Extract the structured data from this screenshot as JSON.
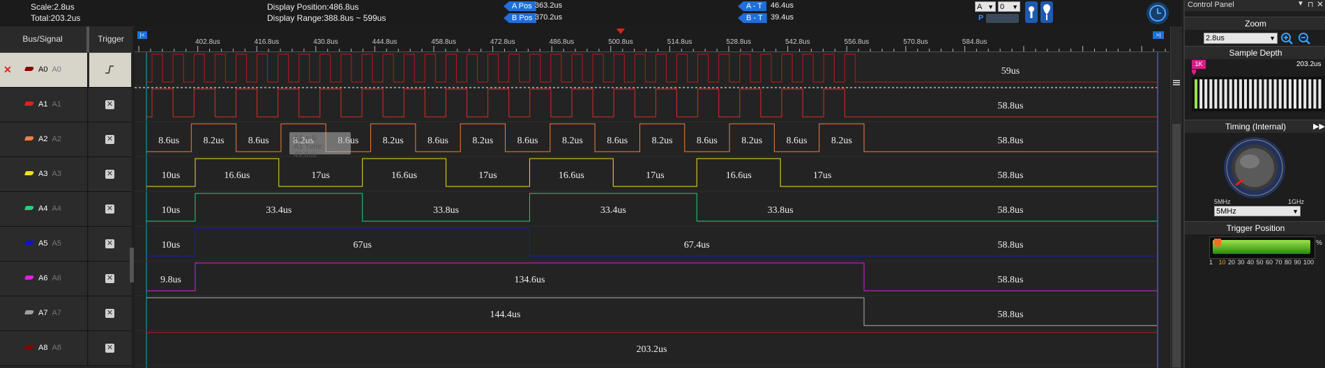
{
  "top": {
    "scale": "Scale:2.8us",
    "total": "Total:203.2us",
    "display_position": "Display Position:486.8us",
    "display_range": "Display Range:388.8us ~ 599us",
    "a_pos_label": "A Pos",
    "a_pos_value": "363.2us",
    "b_pos_label": "B Pos",
    "b_pos_value": "370.2us",
    "a_t_label": "A - T",
    "a_t_value": "46.4us",
    "b_t_label": "B - T",
    "b_t_value": "39.4us",
    "cursor_select_a": "A",
    "cursor_select_num": "0",
    "p_label": "P"
  },
  "left": {
    "header_bus": "Bus/Signal",
    "header_trigger": "Trigger",
    "signals": [
      {
        "name": "A0",
        "alias": "A0",
        "color": "#8b0000"
      },
      {
        "name": "A1",
        "alias": "A1",
        "color": "#e02020"
      },
      {
        "name": "A2",
        "alias": "A2",
        "color": "#f08040"
      },
      {
        "name": "A3",
        "alias": "A3",
        "color": "#f0e020"
      },
      {
        "name": "A4",
        "alias": "A4",
        "color": "#20d080"
      },
      {
        "name": "A5",
        "alias": "A5",
        "color": "#1010d0"
      },
      {
        "name": "A6",
        "alias": "A6",
        "color": "#e020e0"
      },
      {
        "name": "A7",
        "alias": "A7",
        "color": "#a0a0a0"
      },
      {
        "name": "A8",
        "alias": "A8",
        "color": "#8b0000"
      }
    ]
  },
  "ruler": {
    "ticks": [
      "402.8us",
      "416.8us",
      "430.8us",
      "444.8us",
      "458.8us",
      "472.8us",
      "486.8us",
      "500.8us",
      "514.8us",
      "528.8us",
      "542.8us",
      "556.8us",
      "570.8us",
      "584.8us"
    ]
  },
  "channels": [
    {
      "color": "#c01818",
      "period": 30,
      "start": 22,
      "widths_label": [],
      "tail_label": "59us"
    },
    {
      "color": "#e02828",
      "period": 60,
      "start": 22,
      "labels": [],
      "tail_label": "58.8us"
    },
    {
      "color": "#f08040",
      "labels": [
        "8.6us",
        "8.2us",
        "8.6us",
        "8.2us",
        "8.6us",
        "8.2us",
        "8.6us",
        "8.2us",
        "8.6us",
        "8.2us",
        "8.6us",
        "8.2us",
        "8.6us",
        "8.2us",
        "8.6us",
        "8.2us"
      ],
      "tail_label": "58.8us"
    },
    {
      "color": "#f0e020",
      "labels": [
        "10us",
        "16.6us",
        "17us",
        "16.6us",
        "17us",
        "16.6us",
        "17us",
        "16.6us",
        "17us"
      ],
      "tail_label": "58.8us"
    },
    {
      "color": "#20d080",
      "labels": [
        "10us",
        "33.4us",
        "33.8us",
        "33.4us",
        "33.8us"
      ],
      "tail_label": "58.8us"
    },
    {
      "color": "#1818d0",
      "labels": [
        "10us",
        "67us",
        "67.4us"
      ],
      "tail_label": "58.8us"
    },
    {
      "color": "#e020e0",
      "labels": [
        "9.8us",
        "134.6us"
      ],
      "tail_label": "58.8us"
    },
    {
      "color": "#b0b0b0",
      "labels": [
        "144.4us"
      ],
      "tail_label": "58.8us"
    },
    {
      "color": "#c01818",
      "labels": [
        "203.2us"
      ],
      "tail_label": ""
    }
  ],
  "tooltip": {
    "line1": "A1 = 0",
    "line2": "A1 Time: 49.8us"
  },
  "right": {
    "title": "Control Panel",
    "zoom_title": "Zoom",
    "zoom_value": "2.8us",
    "sample_depth_title": "Sample Depth",
    "sample_badge": "1K",
    "sample_value": "203.2us",
    "timing_title": "Timing (Internal)",
    "knob_min": "5MHz",
    "knob_max": "1GHz",
    "timing_value": "5MHz",
    "trigger_title": "Trigger Position",
    "trigger_percent": "%",
    "trigger_scale": [
      "1",
      "10",
      "20",
      "30",
      "40",
      "50",
      "60",
      "70",
      "80",
      "90",
      "100"
    ]
  }
}
